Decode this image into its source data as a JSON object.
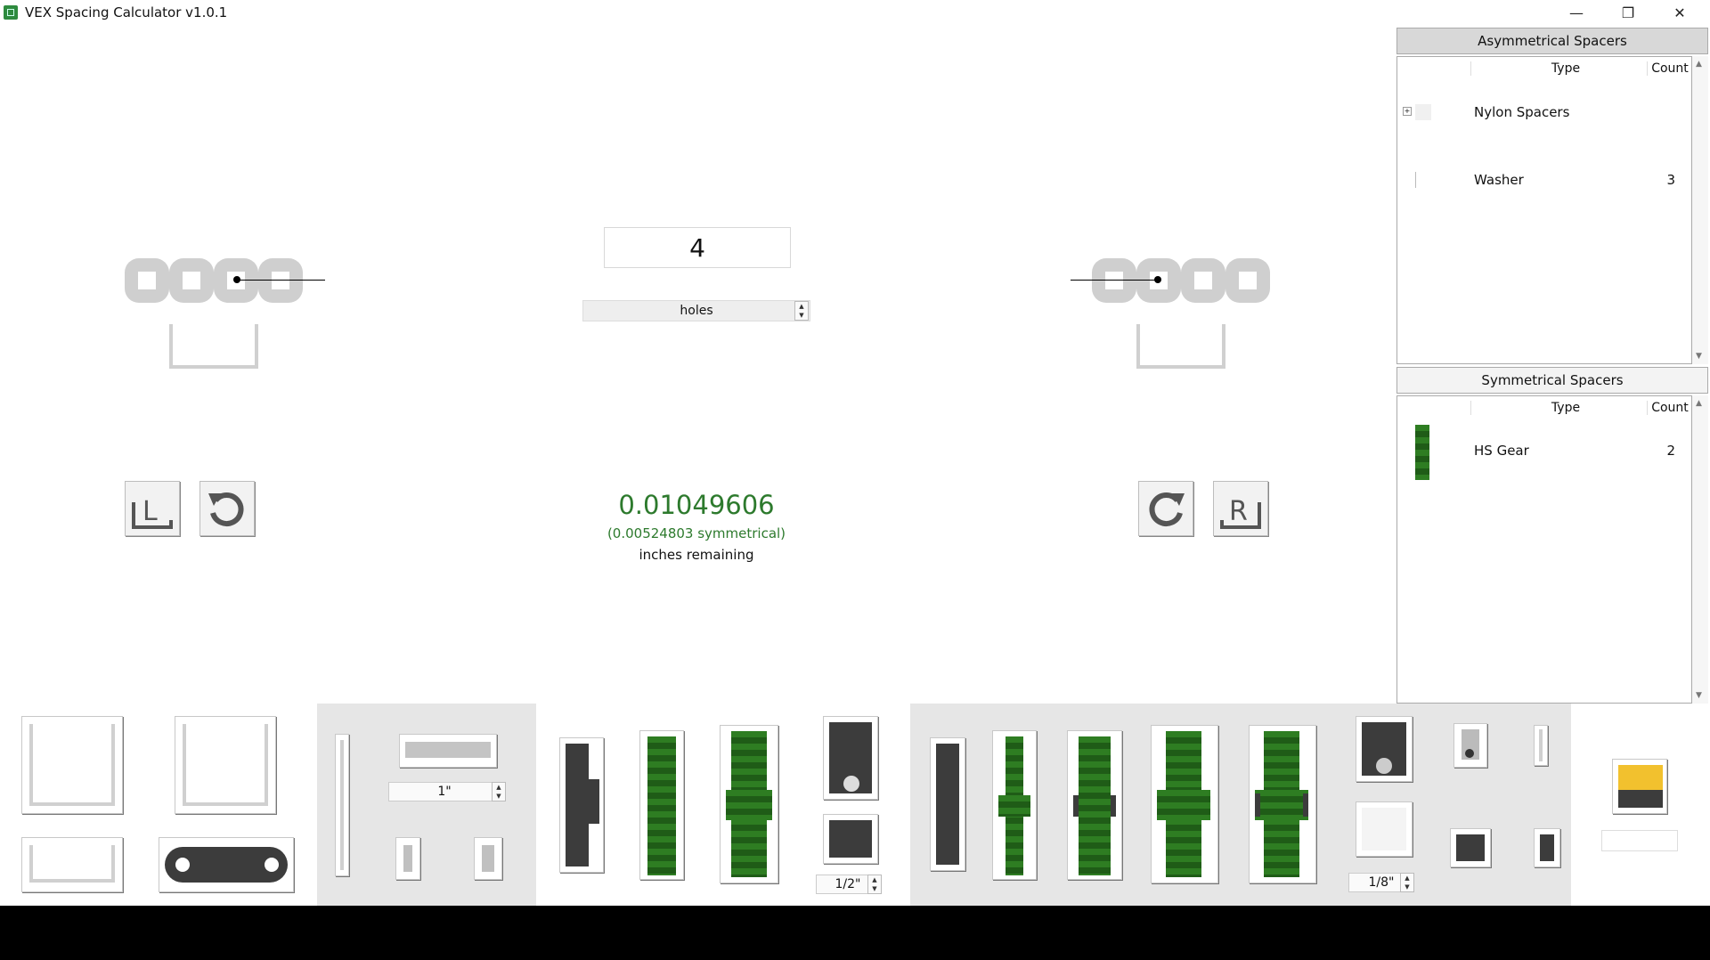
{
  "window": {
    "title": "VEX Spacing Calculator v1.0.1",
    "minimize": "—",
    "restore": "❐",
    "close": "✕"
  },
  "center": {
    "holes_value": "4",
    "unit": "holes",
    "result_value": "0.01049606",
    "result_symmetrical": "(0.00524803 symmetrical)",
    "result_label": "inches remaining"
  },
  "left_controls": {
    "l_button": "L"
  },
  "right_controls": {
    "r_button": "R"
  },
  "asymmetrical": {
    "header": "Asymmetrical Spacers",
    "columns": {
      "type": "Type",
      "count": "Count"
    },
    "rows": [
      {
        "type": "Nylon Spacers",
        "count": ""
      },
      {
        "type": "Washer",
        "count": "3"
      }
    ]
  },
  "symmetrical": {
    "header": "Symmetrical Spacers",
    "columns": {
      "type": "Type",
      "count": "Count"
    },
    "rows": [
      {
        "type": "HS Gear",
        "count": "2"
      }
    ]
  },
  "toolbar": {
    "length_select_1": "1\"",
    "length_select_2": "1/2\"",
    "length_select_3": "1/8\""
  },
  "colors": {
    "green_text": "#2d7a2d",
    "gear_green": "#2e7d22",
    "yellow": "#f2c12e",
    "dark_part": "#3c3c3c"
  }
}
